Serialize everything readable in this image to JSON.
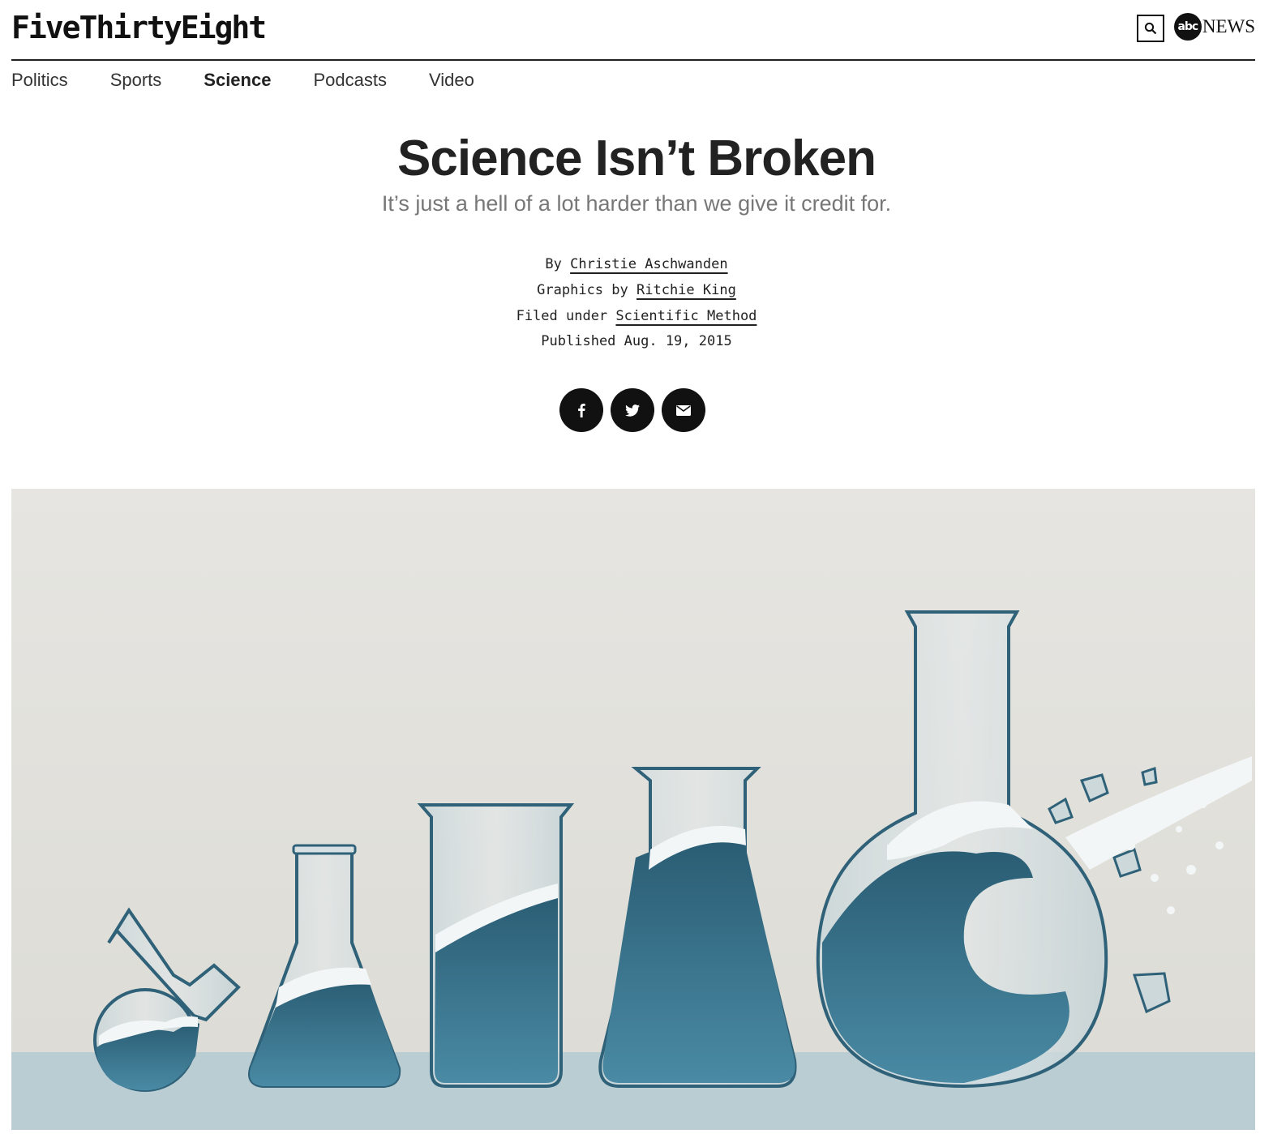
{
  "brand": {
    "logo": "FiveThirtyEight",
    "partner_badge": "abc",
    "partner_name": "NEWS"
  },
  "nav": [
    {
      "label": "Politics",
      "active": false
    },
    {
      "label": "Sports",
      "active": false
    },
    {
      "label": "Science",
      "active": true
    },
    {
      "label": "Podcasts",
      "active": false
    },
    {
      "label": "Video",
      "active": false
    }
  ],
  "article": {
    "title": "Science Isn’t Broken",
    "dek": "It’s just a hell of a lot harder than we give it credit for.",
    "byline_prefix": "By",
    "author": "Christie Aschwanden",
    "graphics_prefix": "Graphics by",
    "graphics_author": "Ritchie King",
    "filed_prefix": "Filed under",
    "filed_topic": "Scientific Method",
    "published": "Published Aug. 19, 2015"
  },
  "share": [
    "facebook-icon",
    "twitter-icon",
    "email-icon"
  ],
  "colors": {
    "text": "#222222",
    "dek": "#777777",
    "water": "#3f7f99",
    "water_dark": "#1f4d62",
    "foam": "#f2f6f7",
    "backdrop": "#e3e2de",
    "table": "#b9cdd3"
  }
}
